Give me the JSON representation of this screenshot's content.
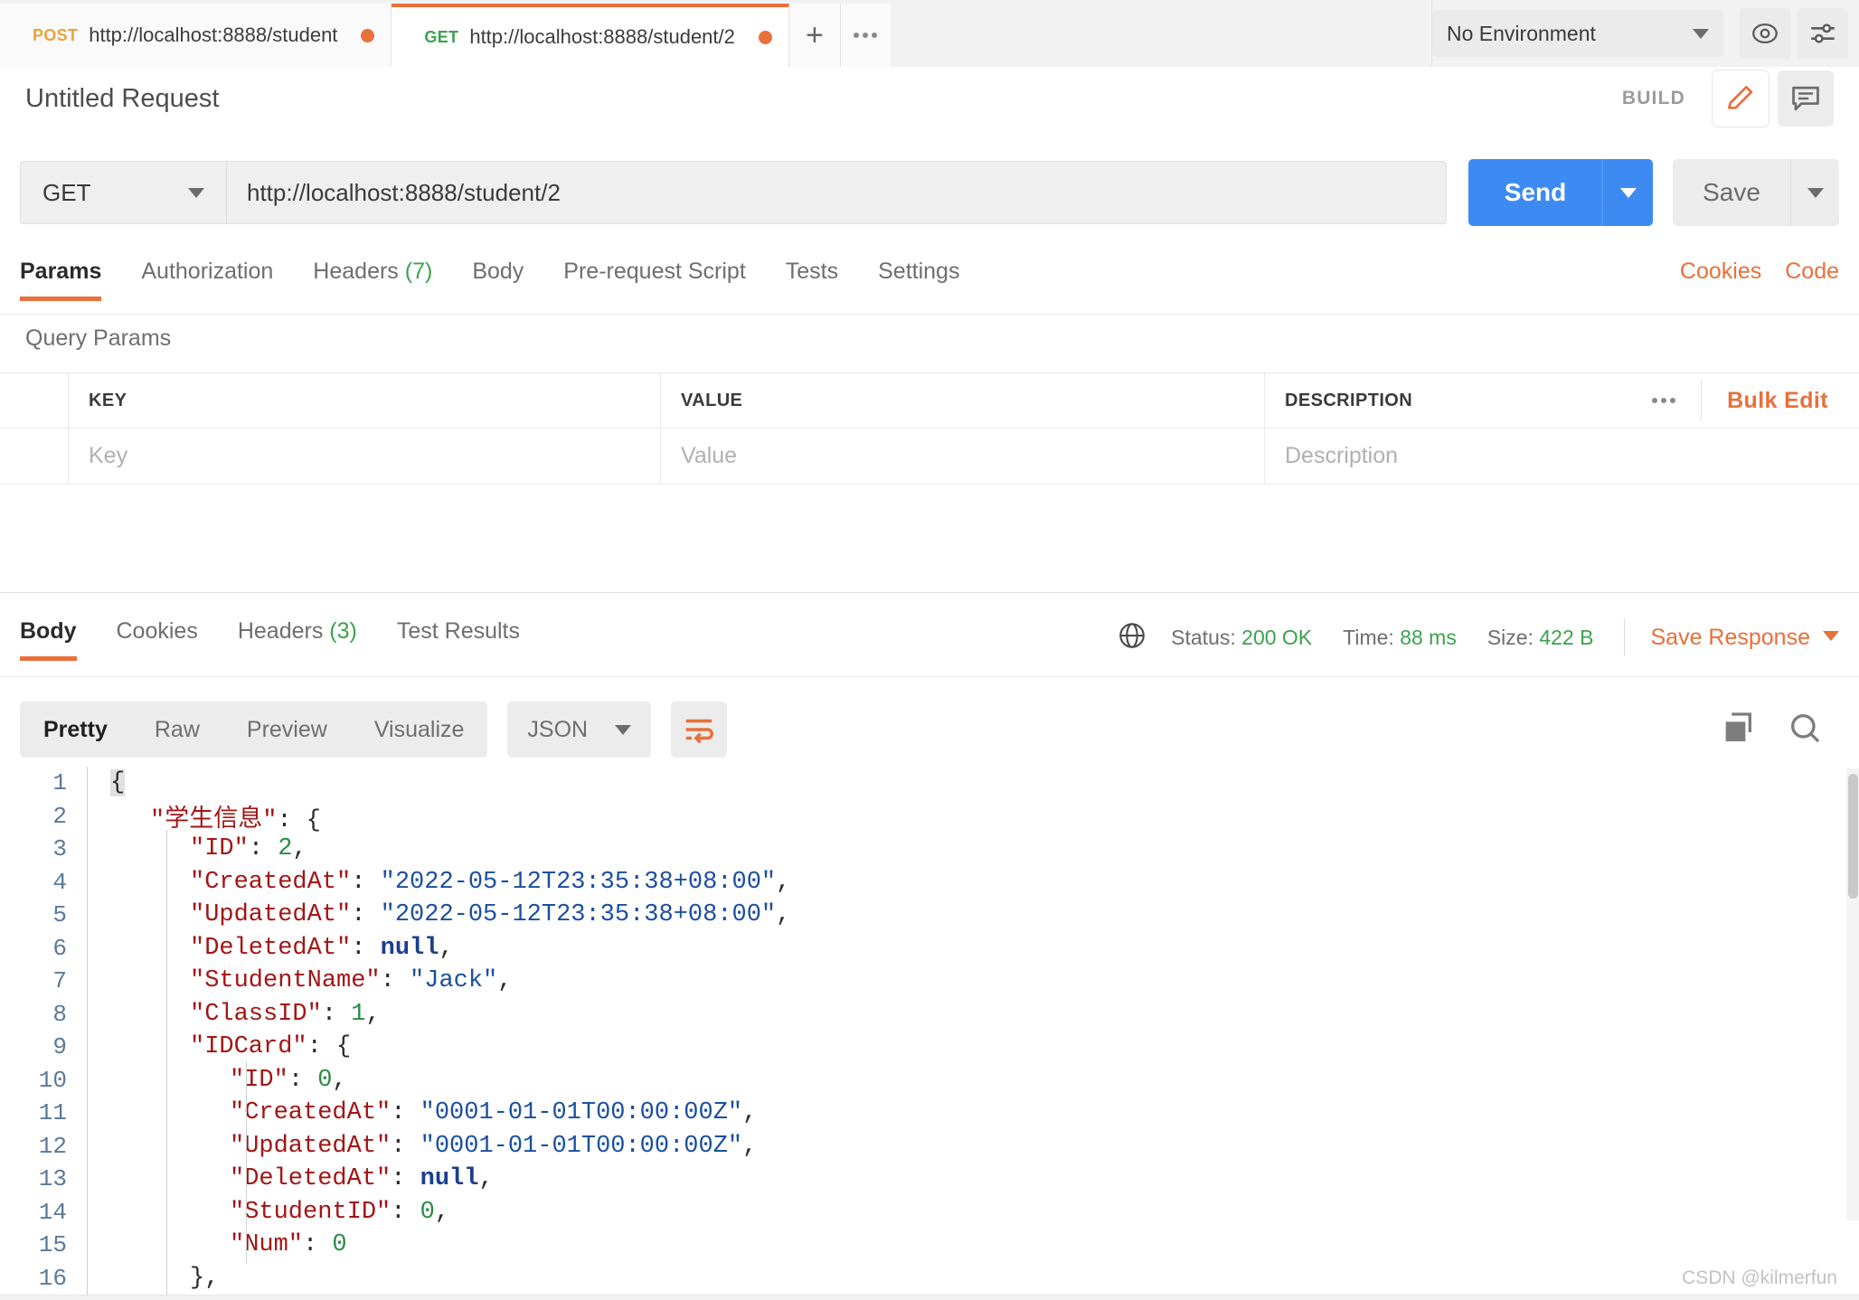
{
  "tabbar": {
    "tabs": [
      {
        "method": "POST",
        "url": "http://localhost:8888/student",
        "active": false
      },
      {
        "method": "GET",
        "url": "http://localhost:8888/student/2",
        "active": true
      }
    ],
    "new_tab_label": "+",
    "more_icon": "more-horizontal-icon",
    "environment": {
      "selected": "No Environment",
      "eye_icon": "eye-icon",
      "settings_icon": "sliders-icon"
    }
  },
  "title_row": {
    "request_title": "Untitled Request",
    "build_label": "BUILD",
    "edit_icon": "pencil-icon",
    "comment_icon": "comment-icon"
  },
  "url_row": {
    "method": "GET",
    "url": "http://localhost:8888/student/2",
    "send_label": "Send",
    "save_label": "Save"
  },
  "request_tabs": {
    "items": [
      {
        "label": "Params",
        "count": "",
        "active": true
      },
      {
        "label": "Authorization",
        "count": "",
        "active": false
      },
      {
        "label": "Headers",
        "count": "(7)",
        "active": false
      },
      {
        "label": "Body",
        "count": "",
        "active": false
      },
      {
        "label": "Pre-request Script",
        "count": "",
        "active": false
      },
      {
        "label": "Tests",
        "count": "",
        "active": false
      },
      {
        "label": "Settings",
        "count": "",
        "active": false
      }
    ],
    "cookies_link": "Cookies",
    "code_link": "Code"
  },
  "query_params": {
    "section_label": "Query Params",
    "columns": [
      "KEY",
      "VALUE",
      "DESCRIPTION"
    ],
    "row_placeholders": {
      "key": "Key",
      "value": "Value",
      "description": "Description"
    },
    "more_icon": "more-horizontal-icon",
    "bulk_edit_label": "Bulk Edit"
  },
  "response": {
    "tabs": [
      {
        "label": "Body",
        "count": "",
        "active": true
      },
      {
        "label": "Cookies",
        "count": "",
        "active": false
      },
      {
        "label": "Headers",
        "count": "(3)",
        "active": false
      },
      {
        "label": "Test Results",
        "count": "",
        "active": false
      }
    ],
    "globe_icon": "globe-icon",
    "status_label": "Status:",
    "status_value": "200 OK",
    "time_label": "Time:",
    "time_value": "88 ms",
    "size_label": "Size:",
    "size_value": "422 B",
    "save_response_label": "Save Response",
    "format_tabs": [
      {
        "label": "Pretty",
        "active": true
      },
      {
        "label": "Raw",
        "active": false
      },
      {
        "label": "Preview",
        "active": false
      },
      {
        "label": "Visualize",
        "active": false
      }
    ],
    "language": "JSON",
    "wrap_icon": "word-wrap-icon",
    "copy_icon": "copy-icon",
    "search_icon": "search-icon"
  },
  "code": {
    "lines": [
      {
        "num": "1",
        "indent": 0,
        "tokens": [
          {
            "t": "{",
            "c": "p"
          }
        ]
      },
      {
        "num": "2",
        "indent": 1,
        "tokens": [
          {
            "t": "\"学生信息\"",
            "c": "k"
          },
          {
            "t": ": {",
            "c": "p"
          }
        ]
      },
      {
        "num": "3",
        "indent": 2,
        "tokens": [
          {
            "t": "\"ID\"",
            "c": "k"
          },
          {
            "t": ": ",
            "c": "p"
          },
          {
            "t": "2",
            "c": "n"
          },
          {
            "t": ",",
            "c": "p"
          }
        ]
      },
      {
        "num": "4",
        "indent": 2,
        "tokens": [
          {
            "t": "\"CreatedAt\"",
            "c": "k"
          },
          {
            "t": ": ",
            "c": "p"
          },
          {
            "t": "\"2022-05-12T23:35:38+08:00\"",
            "c": "s"
          },
          {
            "t": ",",
            "c": "p"
          }
        ]
      },
      {
        "num": "5",
        "indent": 2,
        "tokens": [
          {
            "t": "\"UpdatedAt\"",
            "c": "k"
          },
          {
            "t": ": ",
            "c": "p"
          },
          {
            "t": "\"2022-05-12T23:35:38+08:00\"",
            "c": "s"
          },
          {
            "t": ",",
            "c": "p"
          }
        ]
      },
      {
        "num": "6",
        "indent": 2,
        "tokens": [
          {
            "t": "\"DeletedAt\"",
            "c": "k"
          },
          {
            "t": ": ",
            "c": "p"
          },
          {
            "t": "null",
            "c": "nl"
          },
          {
            "t": ",",
            "c": "p"
          }
        ]
      },
      {
        "num": "7",
        "indent": 2,
        "tokens": [
          {
            "t": "\"StudentName\"",
            "c": "k"
          },
          {
            "t": ": ",
            "c": "p"
          },
          {
            "t": "\"Jack\"",
            "c": "s"
          },
          {
            "t": ",",
            "c": "p"
          }
        ]
      },
      {
        "num": "8",
        "indent": 2,
        "tokens": [
          {
            "t": "\"ClassID\"",
            "c": "k"
          },
          {
            "t": ": ",
            "c": "p"
          },
          {
            "t": "1",
            "c": "n"
          },
          {
            "t": ",",
            "c": "p"
          }
        ]
      },
      {
        "num": "9",
        "indent": 2,
        "tokens": [
          {
            "t": "\"IDCard\"",
            "c": "k"
          },
          {
            "t": ": {",
            "c": "p"
          }
        ]
      },
      {
        "num": "10",
        "indent": 3,
        "tokens": [
          {
            "t": "\"ID\"",
            "c": "k"
          },
          {
            "t": ": ",
            "c": "p"
          },
          {
            "t": "0",
            "c": "n"
          },
          {
            "t": ",",
            "c": "p"
          }
        ]
      },
      {
        "num": "11",
        "indent": 3,
        "tokens": [
          {
            "t": "\"CreatedAt\"",
            "c": "k"
          },
          {
            "t": ": ",
            "c": "p"
          },
          {
            "t": "\"0001-01-01T00:00:00Z\"",
            "c": "s"
          },
          {
            "t": ",",
            "c": "p"
          }
        ]
      },
      {
        "num": "12",
        "indent": 3,
        "tokens": [
          {
            "t": "\"UpdatedAt\"",
            "c": "k"
          },
          {
            "t": ": ",
            "c": "p"
          },
          {
            "t": "\"0001-01-01T00:00:00Z\"",
            "c": "s"
          },
          {
            "t": ",",
            "c": "p"
          }
        ]
      },
      {
        "num": "13",
        "indent": 3,
        "tokens": [
          {
            "t": "\"DeletedAt\"",
            "c": "k"
          },
          {
            "t": ": ",
            "c": "p"
          },
          {
            "t": "null",
            "c": "nl"
          },
          {
            "t": ",",
            "c": "p"
          }
        ]
      },
      {
        "num": "14",
        "indent": 3,
        "tokens": [
          {
            "t": "\"StudentID\"",
            "c": "k"
          },
          {
            "t": ": ",
            "c": "p"
          },
          {
            "t": "0",
            "c": "n"
          },
          {
            "t": ",",
            "c": "p"
          }
        ]
      },
      {
        "num": "15",
        "indent": 3,
        "tokens": [
          {
            "t": "\"Num\"",
            "c": "k"
          },
          {
            "t": ": ",
            "c": "p"
          },
          {
            "t": "0",
            "c": "n"
          }
        ]
      },
      {
        "num": "16",
        "indent": 2,
        "tokens": [
          {
            "t": "},",
            "c": "p"
          }
        ]
      }
    ]
  },
  "watermark": "CSDN @kilmerfun",
  "colors": {
    "accent_orange": "#e8703a",
    "send_blue": "#3d8bf2",
    "success_green": "#3aa34c",
    "json_key": "#a31515",
    "json_string": "#1a4fa0",
    "json_number": "#2a8b45",
    "json_null": "#1a3f8f"
  }
}
